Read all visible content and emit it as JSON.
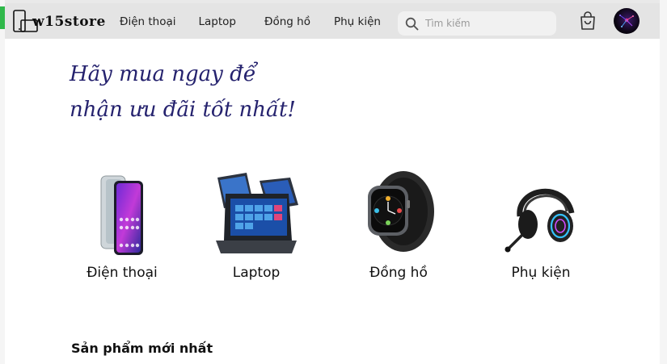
{
  "navbar": {
    "logo_text": "w15store",
    "links": [
      {
        "label": "Điện thoại"
      },
      {
        "label": "Laptop"
      },
      {
        "label": "Đồng hồ"
      },
      {
        "label": "Phụ kiện"
      }
    ],
    "search": {
      "placeholder": "Tìm kiếm",
      "value": ""
    },
    "icons": [
      "search-icon",
      "shopping-bag-icon",
      "avatar"
    ]
  },
  "hero": {
    "line1": "Hãy mua ngay để",
    "line2": "nhận ưu đãi tốt nhất!"
  },
  "categories": [
    {
      "label": "Điện thoại",
      "icon": "smartphone-image"
    },
    {
      "label": "Laptop",
      "icon": "laptop-image"
    },
    {
      "label": "Đồng hồ",
      "icon": "smartwatch-image"
    },
    {
      "label": "Phụ kiện",
      "icon": "headset-image"
    }
  ],
  "section": {
    "title": "Sản phẩm mới nhất"
  },
  "colors": {
    "accent_green": "#2fb84a",
    "hero_text": "#25226e",
    "navbar_bg": "#e4e4e4"
  }
}
